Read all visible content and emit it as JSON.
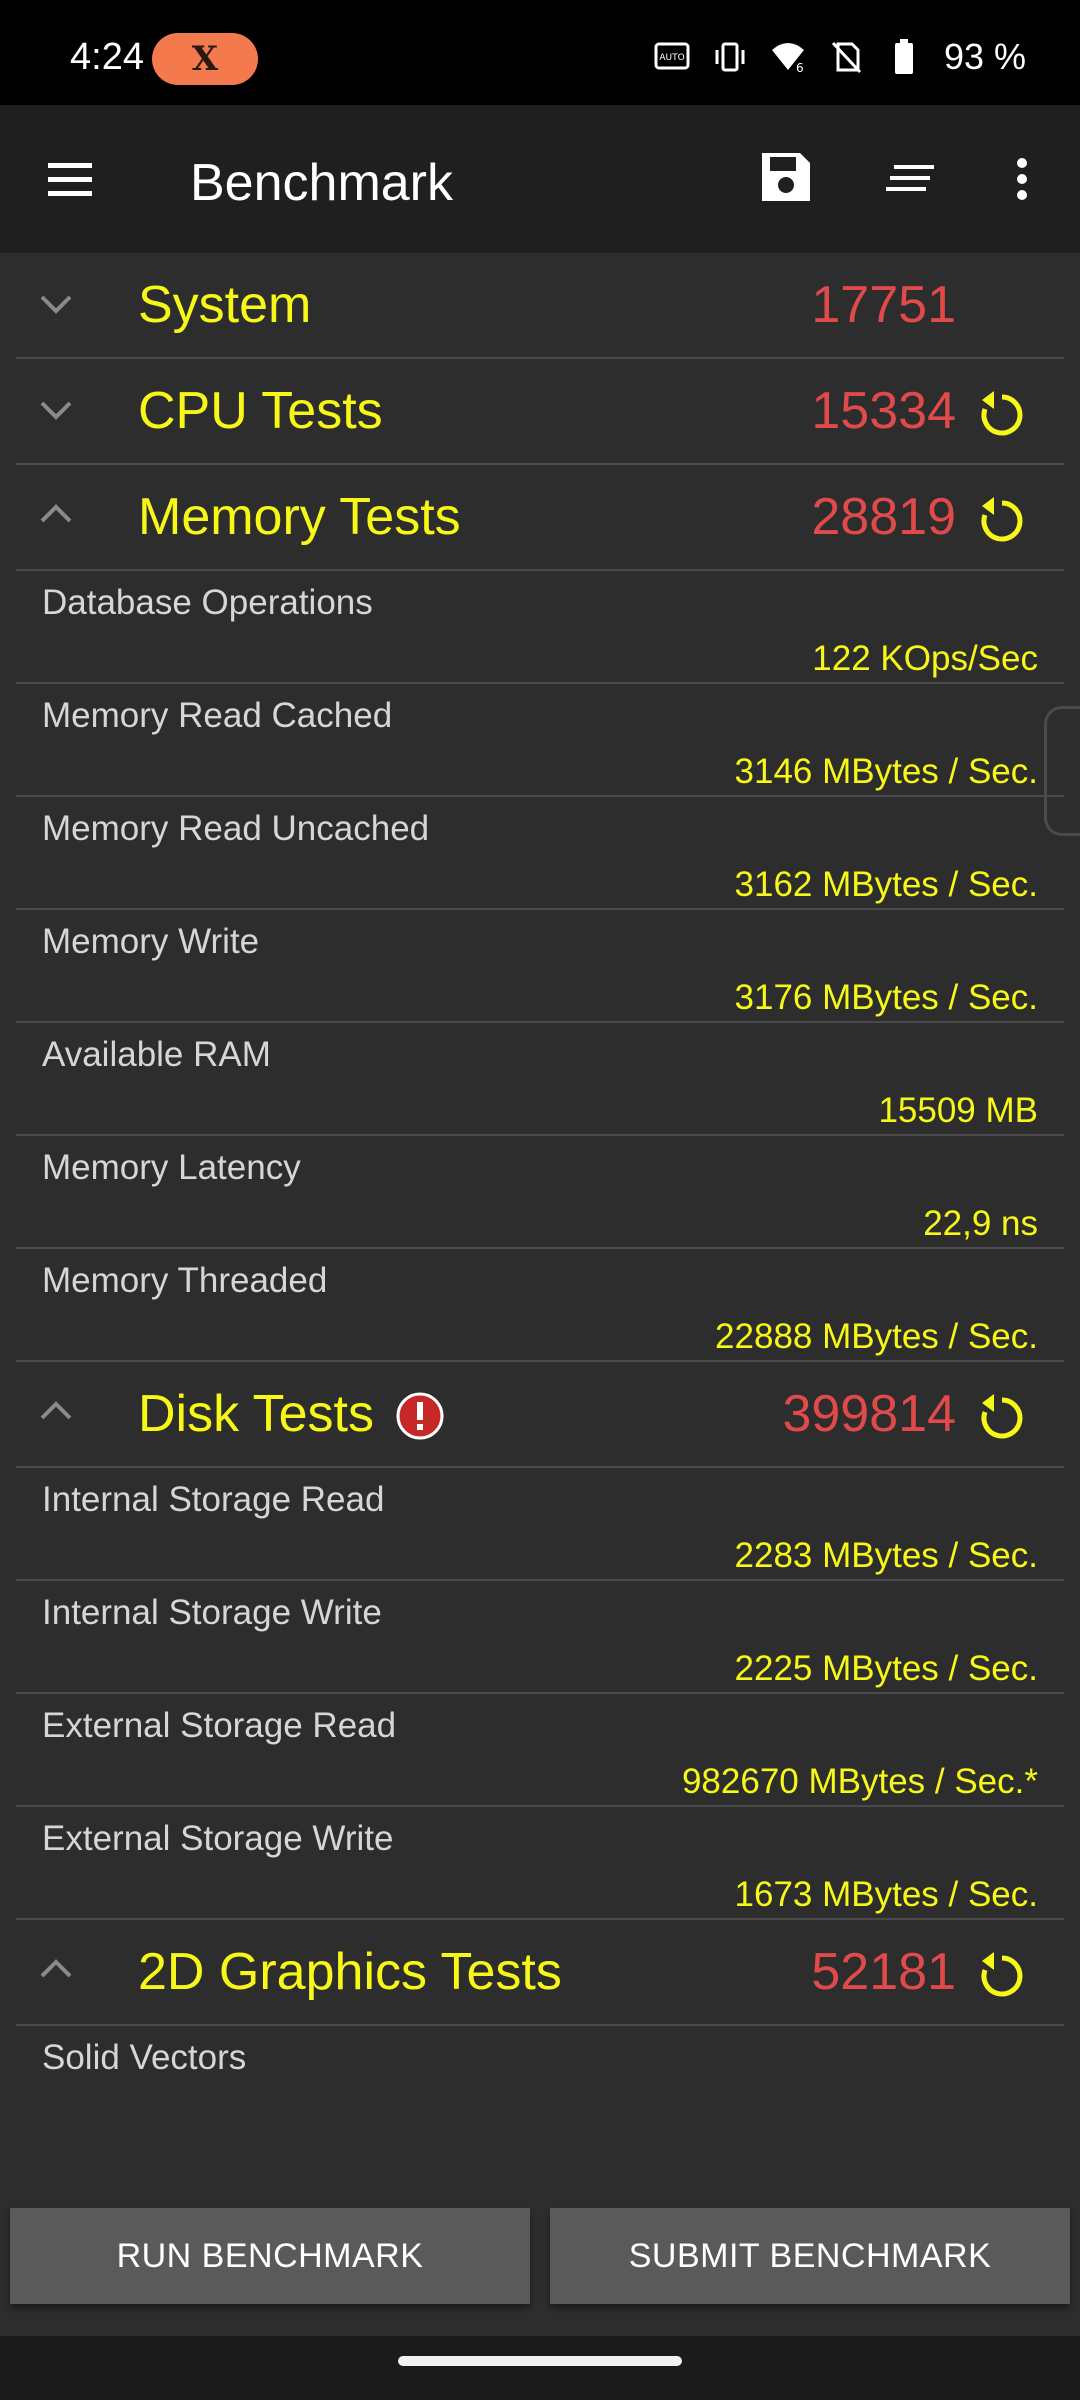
{
  "status": {
    "time": "4:24",
    "x_badge": "X",
    "battery": "93 %",
    "icons": [
      "auto-hz-icon",
      "vibrate-icon",
      "wifi-6-icon",
      "no-sim-icon",
      "battery-icon"
    ]
  },
  "app_bar": {
    "title": "Benchmark",
    "icons": [
      "menu-icon",
      "save-icon",
      "sort-icon",
      "more-vert-icon"
    ]
  },
  "sections": {
    "system": {
      "title": "System",
      "score": "17751",
      "expanded": false
    },
    "cpu": {
      "title": "CPU Tests",
      "score": "15334",
      "expanded": false
    },
    "memory": {
      "title": "Memory Tests",
      "score": "28819",
      "expanded": true,
      "rows": [
        {
          "label": "Database Operations",
          "value": "122 KOps/Sec"
        },
        {
          "label": "Memory Read Cached",
          "value": "3146 MBytes / Sec."
        },
        {
          "label": "Memory Read Uncached",
          "value": "3162 MBytes / Sec."
        },
        {
          "label": "Memory Write",
          "value": "3176 MBytes / Sec."
        },
        {
          "label": "Available RAM",
          "value": "15509 MB"
        },
        {
          "label": "Memory Latency",
          "value": "22,9 ns"
        },
        {
          "label": "Memory Threaded",
          "value": "22888 MBytes / Sec."
        }
      ]
    },
    "disk": {
      "title": "Disk Tests",
      "score": "399814",
      "expanded": true,
      "warning": true,
      "rows": [
        {
          "label": "Internal Storage Read",
          "value": "2283 MBytes / Sec."
        },
        {
          "label": "Internal Storage Write",
          "value": "2225 MBytes / Sec."
        },
        {
          "label": "External Storage Read",
          "value": "982670 MBytes / Sec.*"
        },
        {
          "label": "External Storage Write",
          "value": "1673 MBytes / Sec."
        }
      ]
    },
    "graphics2d": {
      "title": "2D Graphics Tests",
      "score": "52181",
      "expanded": true,
      "rows": [
        {
          "label": "Solid Vectors",
          "value": ""
        }
      ]
    }
  },
  "buttons": {
    "run": "RUN BENCHMARK",
    "submit": "SUBMIT BENCHMARK"
  },
  "colors": {
    "accent_title": "#f7f718",
    "score": "#e04a4a",
    "background": "#2d2d2d",
    "app_bar": "#1f1f1f",
    "x_badge": "#f47a4e"
  }
}
